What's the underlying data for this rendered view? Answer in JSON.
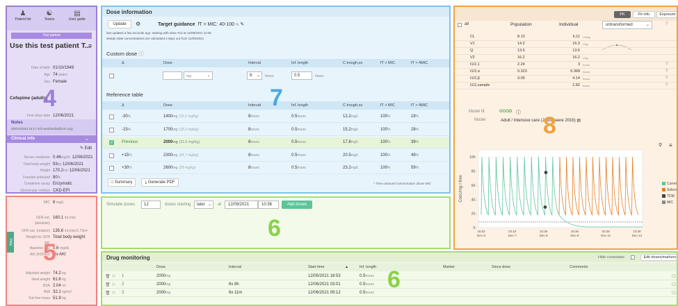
{
  "nav": {
    "patient_list": "Patient list",
    "teams": "Teams",
    "user_guide": "User guide"
  },
  "left": {
    "test_patient": "Test patient",
    "title": "Use this test patient T...",
    "dob_label": "Date of birth",
    "dob": "01/10/1949",
    "age_label": "Age",
    "age": "74",
    "age_unit": "years",
    "sex_label": "Sex",
    "sex": "Female",
    "drug": "Cefepime (adults)",
    "first_dose_label": "First dose date",
    "first_dose": "12/06/2021",
    "notes_title": "Notes",
    "notes_text": "(09/24/2023 15:17 erik.westlandia@mm.org)",
    "clinical_title": "Clinical info",
    "edit": "Edit",
    "clin": [
      {
        "label": "Serum creatinine",
        "value": "0.46",
        "unit": "mg/dL",
        "date": "12/06/2021"
      },
      {
        "label": "Total body weight",
        "value": "93",
        "unit": "kg",
        "date": "12/06/2021"
      },
      {
        "label": "Height",
        "value": "170.2",
        "unit": "cm",
        "date": "12/06/2021"
      },
      {
        "label": "Fraction unbound",
        "value": "80",
        "unit": "%",
        "date": ""
      },
      {
        "label": "Creatinine assay",
        "value": "Enzymatic",
        "unit": "",
        "date": ""
      },
      {
        "label": "Glomerular method",
        "value": "CKD-EPI",
        "unit": "",
        "date": ""
      }
    ]
  },
  "left2": {
    "mic_label": "MIC",
    "mic": "8",
    "mic_unit": "mg/L",
    "gfr_abs_label": "GFR est.",
    "gfr_abs_label2": "(absolute)",
    "gfr_abs": "160.1",
    "gfr_abs_unit": "mL/min",
    "gfr_rel_label": "GFR est. (relative)",
    "gfr_rel": "135.6",
    "gfr_rel_unit": "mL/min/1.73m²",
    "wt_label": "Weight for GFR",
    "wt_label2": "est.",
    "wt": "Total body weight",
    "bscr_label": "Baseline SCr",
    "bscr": "0.6",
    "bscr_unit": "mg/dL",
    "aki_label": "AKI (KDIGO)",
    "aki": "No AKI",
    "help": "Help",
    "adj_label": "Adjusted weight",
    "adj": "74.2",
    "adj_unit": "kg",
    "ideal_label": "Ideal weight",
    "ideal": "61.6",
    "ideal_unit": "kg",
    "bsa_label": "BSA",
    "bsa": "2.04",
    "bsa_unit": "m²",
    "bmi_label": "BMI",
    "bmi": "32.1",
    "bmi_unit": "kg/m2",
    "ffm_label": "Fat free mass",
    "ffm": "51.9",
    "ffm_unit": "kg"
  },
  "dose": {
    "title": "Dose information",
    "update": "Update",
    "target": "Target guidance",
    "target_val": "fT > MIC: 40-100",
    "target_unit": "%",
    "line1": "last updated a few seconds ago: starting with dose #12 at 12/09/2021 10:36",
    "line2": "steady state concentrations are calculated 4 days out from 12/09/2021",
    "custom_title": "Custom dose",
    "cols": [
      "Δ",
      "Dose",
      "Interval",
      "Inf. length",
      "C trough,ss",
      "fT > MIC",
      "fT > 4MIC"
    ],
    "custom_unit": "mg",
    "custom_interval": "8",
    "custom_interval_unit": "hours",
    "custom_inf": "0.5",
    "custom_inf_unit": "hours",
    "ref_title": "Reference table",
    "rows": [
      {
        "delta": "-30",
        "dunit": "%",
        "dose": "1400",
        "mgkg": "(15.1 mg/kg)",
        "interval": "8",
        "inf": "0.5",
        "ctr": "12.2",
        "mic": "100",
        "mic4": "18"
      },
      {
        "delta": "-15",
        "dunit": "%",
        "dose": "1700",
        "mgkg": "(18.3 mg/kg)",
        "interval": "8",
        "inf": "0.5",
        "ctr": "15.2",
        "mic": "100",
        "mic4": "28"
      },
      {
        "delta": "Previous",
        "dunit": "",
        "dose": "2000",
        "mgkg": "(21.5 mg/kg)",
        "interval": "8",
        "inf": "0.5",
        "ctr": "17.8",
        "mic": "100",
        "mic4": "39"
      },
      {
        "delta": "+15",
        "dunit": "%",
        "dose": "2300",
        "mgkg": "(24.7 mg/kg)",
        "interval": "8",
        "inf": "0.5",
        "ctr": "20.5",
        "mic": "100",
        "mic4": "49"
      },
      {
        "delta": "+30",
        "dunit": "%",
        "dose": "2600",
        "mgkg": "(28 mg/kg)",
        "interval": "8",
        "inf": "0.5",
        "ctr": "23.2",
        "mic": "100",
        "mic4": "59"
      }
    ],
    "summary": "Summary",
    "pdf": "Generate PDF",
    "footnote": "* Time unbound concentration above MIC",
    "hours": "hours",
    "mgL": "mg/L",
    "mg": "mg",
    "pct": "%"
  },
  "sim": {
    "label": "Simulate doses",
    "n": "12",
    "starting": "doses starting",
    "later": "later",
    "at": "at",
    "date": "12/09/2021",
    "time": "10:36",
    "add": "Add doses"
  },
  "monitor": {
    "title": "Drug monitoring",
    "hide": "Hide covariates",
    "edit": "Edit doses/markers",
    "cols": [
      "Dose",
      "Interval",
      "Start time",
      "Inf. length",
      "Marker",
      "Since dose",
      "Comments"
    ],
    "rows": [
      {
        "n": "1",
        "dose": "2000",
        "interval": "",
        "start": "12/05/2021 18:53",
        "inf": "0.5"
      },
      {
        "n": "2",
        "dose": "2000",
        "interval": "6x 8h",
        "start": "12/06/2021 03:01",
        "inf": "0.5"
      },
      {
        "n": "3",
        "dose": "2000",
        "interval": "6x 11m",
        "start": "12/06/2021 09:12",
        "inf": "0.5"
      }
    ]
  },
  "pk": {
    "tabs": [
      "PK",
      "Fit info",
      "Exposure"
    ],
    "all": "all",
    "pop": "Population",
    "ind": "Individual",
    "select": "untransformed",
    "params": [
      {
        "name": "CL",
        "pop": "8.13",
        "ind": "6.11",
        "unit": "L/h/kg"
      },
      {
        "name": "V1",
        "pop": "14.2",
        "ind": "16.3",
        "unit": "L/kg"
      },
      {
        "name": "Q",
        "pop": "13.6",
        "ind": "13.6",
        "unit": ""
      },
      {
        "name": "V2",
        "pop": "16.2",
        "ind": "16.2",
        "unit": "L/kg"
      },
      {
        "name": "t1/2,1",
        "pop": "2.24",
        "ind": "3",
        "unit": "hours"
      },
      {
        "name": "t1/2,α",
        "pop": "0.323",
        "ind": "0.368",
        "unit": "hours"
      },
      {
        "name": "t1/2,β",
        "pop": "3.09",
        "ind": "4.14",
        "unit": "hours"
      },
      {
        "name": "t1/2,sample",
        "pop": "",
        "ind": "2.82",
        "unit": "hours"
      }
    ],
    "fit_label": "Model fit",
    "fit": "GOOD",
    "model_label": "Model",
    "model": "Adult / Intensive care (Jonckheere 2016)",
    "ylabel": "Conc/mg·l free",
    "legend": [
      "Current",
      "Selected",
      "TDM",
      "MIC"
    ],
    "xticks": [
      "18:53\nDec-5",
      "02:18\nDec-7",
      "10:36\nDec-8",
      "18:36\nDec-9",
      "02:36\nDec-11",
      "10:36\nDec-12"
    ],
    "yticks": [
      "0",
      "20",
      "40",
      "60",
      "80",
      "100"
    ],
    "colors": {
      "current": "#5cc49a",
      "selected": "#e67e22",
      "tdm": "#444444",
      "mic": "#888888"
    },
    "ylim": [
      0,
      110
    ]
  },
  "labels": {
    "n4": "4",
    "n5": "5",
    "n6a": "6",
    "n6b": "6",
    "n7": "7",
    "n8": "8"
  }
}
